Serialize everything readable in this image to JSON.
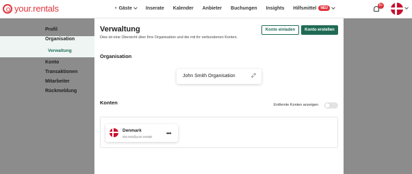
{
  "brand": {
    "name": "your.rentals",
    "accent": "#e0343d",
    "primary": "#1f6b55"
  },
  "nav": {
    "items": [
      {
        "label": "Gäste",
        "has_caret": true,
        "dot": true
      },
      {
        "label": "Inserate"
      },
      {
        "label": "Kalender"
      },
      {
        "label": "Anbieter"
      },
      {
        "label": "Buchungen"
      },
      {
        "label": "Insights"
      },
      {
        "label": "Hilfsmittel",
        "badge": "NEU",
        "has_caret": true
      }
    ],
    "notifications_count": "9+",
    "user_flag": "denmark-flag-icon"
  },
  "sidebar": {
    "items": [
      "Profil",
      "Organisation",
      "Konto",
      "Transaktionen",
      "Mitarbeiter",
      "Rückmeldung"
    ],
    "sub_item": "Verwaltung"
  },
  "modal": {
    "title": "Verwaltung",
    "subtitle": "Dies ist eine Übersicht über Ihre Organisation und die mit ihr verbundenen Konten.",
    "invite_button": "Konto einladen",
    "create_button": "Konto erstellen",
    "organisation_heading": "Organisation",
    "organisation_name": "John Smith Organisation",
    "accounts_heading": "Konten",
    "toggle_label": "Entfernte Konten anzeigen",
    "toggle_on": false,
    "account": {
      "name": "Denmark",
      "url": "site.test@your.rentals",
      "flag": "denmark-flag-icon"
    }
  }
}
